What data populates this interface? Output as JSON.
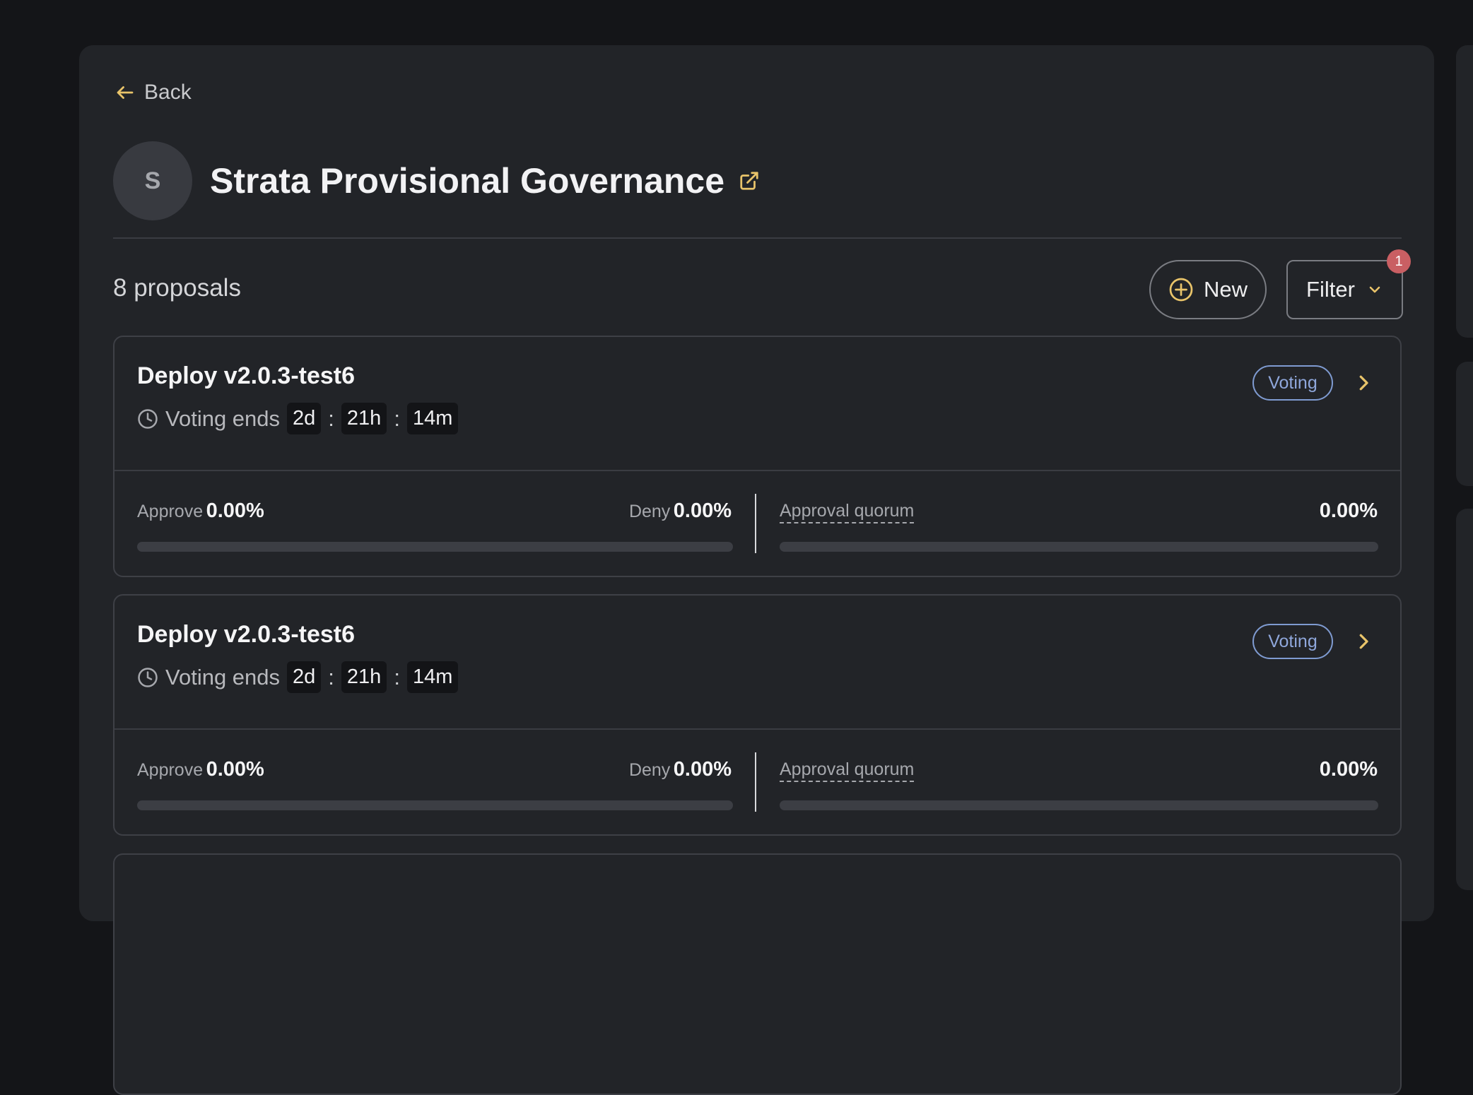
{
  "nav": {
    "back_label": "Back"
  },
  "org": {
    "initial": "S",
    "name": "Strata Provisional Governance"
  },
  "toolbar": {
    "count_label": "8 proposals",
    "new_label": "New",
    "filter_label": "Filter",
    "filter_badge": "1"
  },
  "colors": {
    "accent": "#e9c46a",
    "status_voting": "#8fa7db",
    "badge": "#c95f63"
  },
  "icons": [
    "arrow-left-icon",
    "external-link-icon",
    "plus-circle-icon",
    "chevron-down-icon",
    "clock-icon",
    "chevron-right-icon"
  ],
  "proposals": [
    {
      "title": "Deploy v2.0.3-test6",
      "timer_label": "Voting ends",
      "days": "2d",
      "hours": "21h",
      "minutes": "14m",
      "sep": ":",
      "status": "Voting",
      "approve_label": "Approve",
      "approve_value": "0.00%",
      "approve_fraction": 0,
      "deny_label": "Deny",
      "deny_value": "0.00%",
      "quorum_label": "Approval quorum",
      "quorum_value": "0.00%",
      "quorum_fraction": 0
    },
    {
      "title": "Deploy v2.0.3-test6",
      "timer_label": "Voting ends",
      "days": "2d",
      "hours": "21h",
      "minutes": "14m",
      "sep": ":",
      "status": "Voting",
      "approve_label": "Approve",
      "approve_value": "0.00%",
      "approve_fraction": 0,
      "deny_label": "Deny",
      "deny_value": "0.00%",
      "quorum_label": "Approval quorum",
      "quorum_value": "0.00%",
      "quorum_fraction": 0
    }
  ]
}
